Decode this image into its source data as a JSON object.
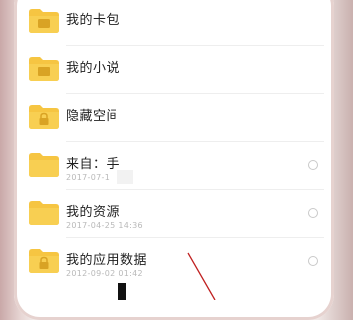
{
  "rows": [
    {
      "name": "我的卡包",
      "subtitle": "",
      "badge": "none",
      "selectable": false
    },
    {
      "name": "我的小说",
      "subtitle": "",
      "badge": "book",
      "selectable": false
    },
    {
      "name": "隐藏空间",
      "subtitle": "",
      "badge": "lock",
      "selectable": false
    },
    {
      "name": "来自：手",
      "subtitle": "2017-07-1",
      "badge": "none",
      "selectable": true
    },
    {
      "name": "我的资源",
      "subtitle": "2017-04-25 14:36",
      "badge": "none",
      "selectable": true
    },
    {
      "name": "我的应用数据",
      "subtitle": "2012-09-02 01:42",
      "badge": "lock",
      "selectable": true
    }
  ],
  "colors": {
    "folder": "#f6c542",
    "folder_tab": "#f0b92f",
    "badge": "#d9a324",
    "annotation": "#c02020"
  },
  "icons": {
    "folder": "folder-icon",
    "lock": "lock-icon",
    "book": "book-icon",
    "radio": "radio-circle-icon"
  }
}
